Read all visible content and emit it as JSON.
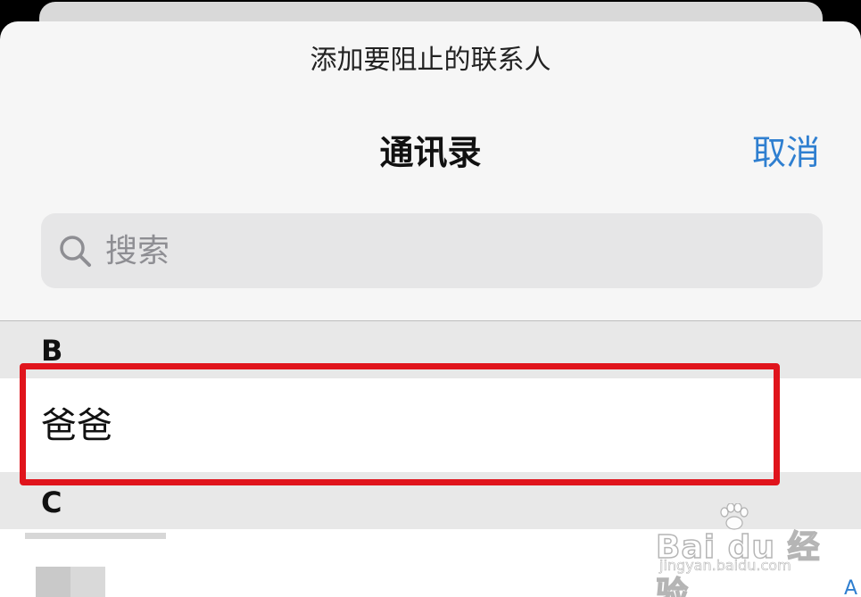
{
  "prompt": "添加要阻止的联系人",
  "nav": {
    "title": "通讯录",
    "cancel_label": "取消"
  },
  "search": {
    "placeholder": "搜索",
    "value": "",
    "icon": "search-icon"
  },
  "sections": [
    {
      "letter": "B",
      "contacts": [
        "爸爸"
      ]
    },
    {
      "letter": "C",
      "contacts": []
    }
  ],
  "index_letter": "A",
  "watermark": {
    "brand": "Bai du 经验",
    "url": "jingyan.baidu.com"
  },
  "colors": {
    "accent": "#2f7fd0",
    "highlight": "#e0141c",
    "sheet_bg": "#f6f6f6",
    "section_bg": "#e8e8e8"
  }
}
